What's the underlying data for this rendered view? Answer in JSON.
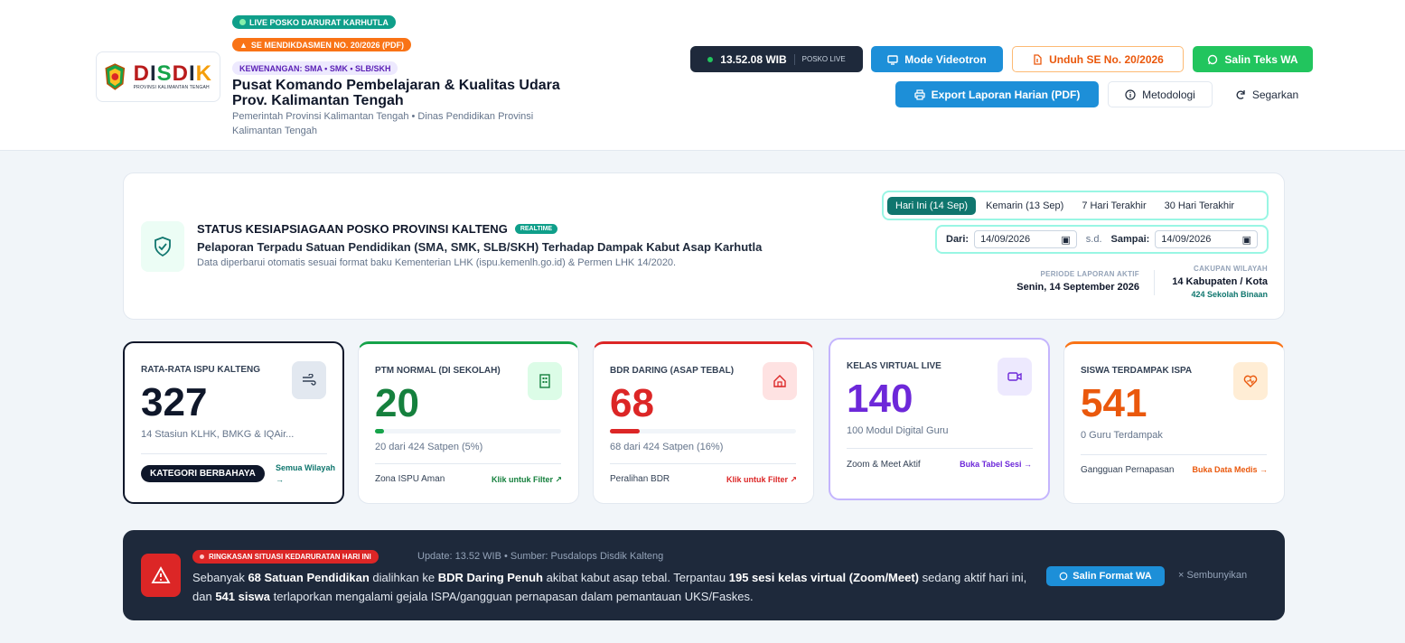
{
  "header": {
    "logo_word": "DISDIK",
    "logo_sub": "PROVINSI KALIMANTAN TENGAH",
    "pill_live": "LIVE POSKO DARURAT KARHUTLA",
    "pill_se": "SE MENDIKDASMEN NO. 20/2026 (PDF)",
    "pill_kewenangan": "KEWENANGAN: SMA • SMK • SLB/SKH",
    "title": "Pusat Komando Pembelajaran & Kualitas Udara Prov. Kalimantan Tengah",
    "subtitle": "Pemerintah Provinsi Kalimantan Tengah • Dinas Pendidikan Provinsi Kalimantan Tengah",
    "clock_time": "13.52.08 WIB",
    "clock_label": "POSKO LIVE",
    "btn_videotron": "Mode Videotron",
    "btn_unduh": "Unduh SE No. 20/2026",
    "btn_wa": "Salin Teks WA",
    "btn_export": "Export Laporan Harian (PDF)",
    "btn_metodologi": "Metodologi",
    "btn_segarkan": "Segarkan"
  },
  "status": {
    "title": "STATUS KESIAPSIAGAAN POSKO PROVINSI KALTENG",
    "badge": "REALTIME",
    "description": "Pelaporan Terpadu Satuan Pendidikan (SMA, SMK, SLB/SKH) Terhadap Dampak Kabut Asap Karhutla",
    "note": "Data diperbarui otomatis sesuai format baku Kementerian LHK (ispu.kemenlh.go.id) & Permen LHK 14/2020.",
    "tabs": [
      "Hari Ini (14 Sep)",
      "Kemarin (13 Sep)",
      "7 Hari Terakhir",
      "30 Hari Terakhir"
    ],
    "label_dari": "Dari:",
    "date_from": "14/09/2026",
    "label_sd": "s.d.",
    "label_sampai": "Sampai:",
    "date_to": "14/09/2026",
    "periode_caption": "PERIODE LAPORAN AKTIF",
    "periode_value": "Senin, 14 September 2026",
    "cakupan_caption": "CAKUPAN WILAYAH",
    "cakupan_value": "14 Kabupaten / Kota",
    "cakupan_sub": "424 Sekolah Binaan"
  },
  "kpis": [
    {
      "label": "RATA-RATA ISPU KALTENG",
      "value": "327",
      "sub": "14 Stasiun KLHK, BMKG & IQAir...",
      "badge": "KATEGORI BERBAHAYA",
      "link": "Semua Wilayah →",
      "color": "#0f172a"
    },
    {
      "label": "PTM NORMAL (DI SEKOLAH)",
      "value": "20",
      "progress": 5,
      "sub": "20 dari 424 Satpen (5%)",
      "foot": "Zona ISPU Aman",
      "link": "Klik untuk Filter ↗",
      "color": "#15803d"
    },
    {
      "label": "BDR DARING (ASAP TEBAL)",
      "value": "68",
      "progress": 16,
      "sub": "68 dari 424 Satpen (16%)",
      "foot": "Peralihan BDR",
      "link": "Klik untuk Filter ↗",
      "color": "#dc2626"
    },
    {
      "label": "KELAS VIRTUAL LIVE",
      "value": "140",
      "sub": "100 Modul Digital Guru",
      "foot": "Zoom & Meet Aktif",
      "link": "Buka Tabel Sesi →",
      "color": "#6d28d9"
    },
    {
      "label": "SISWA TERDAMPAK ISPA",
      "value": "541",
      "sub": "0 Guru Terdampak",
      "foot": "Gangguan Pernapasan",
      "link": "Buka Data Medis →",
      "color": "#ea580c"
    }
  ],
  "banner": {
    "pill": "RINGKASAN SITUASI KEDARURATAN HARI INI",
    "meta": "Update: 13.52 WIB • Sumber: Pusdalops Disdik Kalteng",
    "t1": "Sebanyak ",
    "b1": "68 Satuan Pendidikan",
    "t2": " dialihkan ke ",
    "b2": "BDR Daring Penuh",
    "t3": " akibat kabut asap tebal. Terpantau ",
    "b3": "195 sesi kelas virtual (Zoom/Meet)",
    "t4": " sedang aktif hari ini, dan ",
    "b4": "541 siswa",
    "t5": " terlaporkan mengalami gejala ISPA/gangguan pernapasan dalam pemantauan UKS/Faskes.",
    "btn_copy": "Salin Format WA",
    "btn_hide": "× Sembunyikan"
  }
}
